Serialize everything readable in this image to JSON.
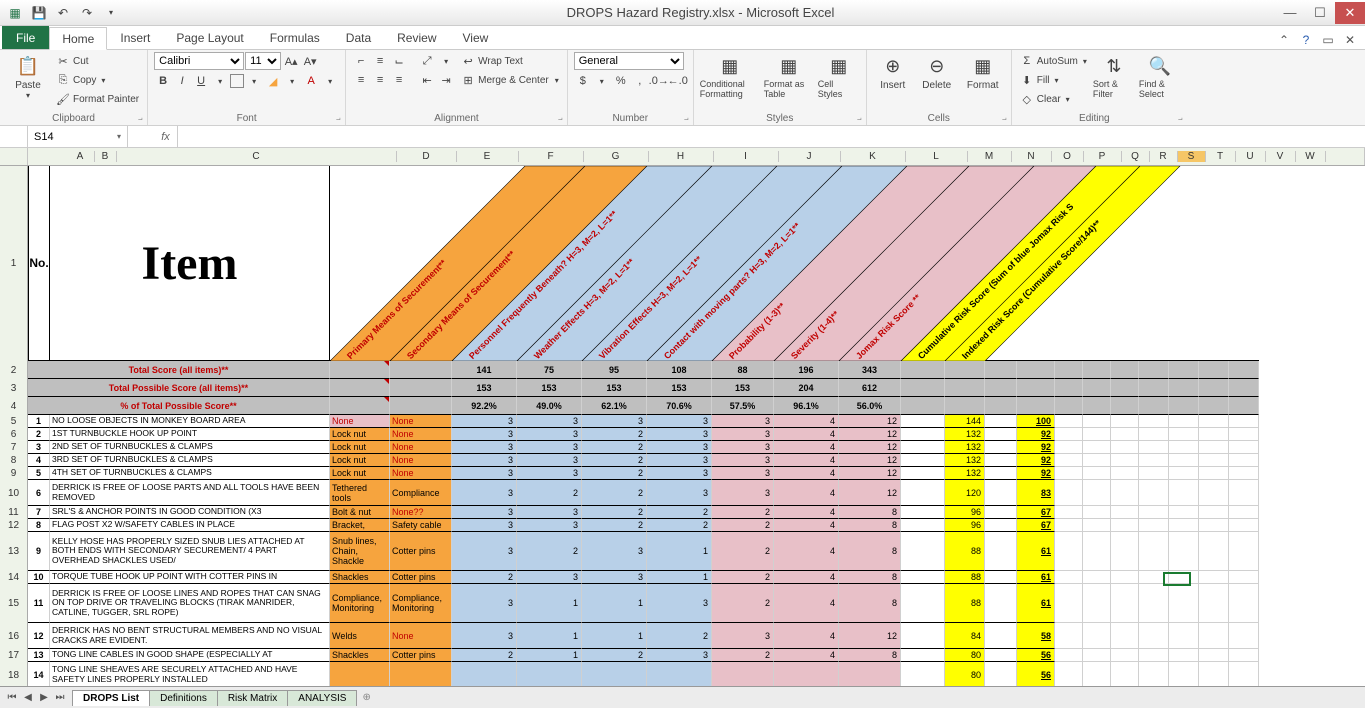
{
  "app": {
    "title": "DROPS Hazard Registry.xlsx - Microsoft Excel"
  },
  "ribbon": {
    "file": "File",
    "tabs": [
      "Home",
      "Insert",
      "Page Layout",
      "Formulas",
      "Data",
      "Review",
      "View"
    ],
    "clipboard": {
      "paste": "Paste",
      "cut": "Cut",
      "copy": "Copy",
      "fp": "Format Painter",
      "label": "Clipboard"
    },
    "font": {
      "name": "Calibri",
      "size": "11",
      "label": "Font"
    },
    "alignment": {
      "wrap": "Wrap Text",
      "merge": "Merge & Center",
      "label": "Alignment"
    },
    "number": {
      "fmt": "General",
      "label": "Number"
    },
    "styles": {
      "cf": "Conditional Formatting",
      "fat": "Format as Table",
      "cs": "Cell Styles",
      "label": "Styles"
    },
    "cells": {
      "ins": "Insert",
      "del": "Delete",
      "fmt": "Format",
      "label": "Cells"
    },
    "editing": {
      "as": "AutoSum",
      "fill": "Fill",
      "clear": "Clear",
      "sort": "Sort & Filter",
      "find": "Find & Select",
      "label": "Editing"
    }
  },
  "namebox": "S14",
  "sheets": [
    "DROPS List",
    "Definitions",
    "Risk Matrix",
    "ANALYSIS"
  ],
  "header_big": {
    "no": "No.",
    "item": "Item"
  },
  "diag": [
    "Primary Means of Securement**",
    "Secondary Means of Securement**",
    "Personnel Frequently Beneath? H=3, M=2, L=1**",
    "Weather Effects H=3, M=2, L=1**",
    "Vibration Effects H=3, M=2, L=1**",
    "Contact with moving parts? H=3, M=2, L=1**",
    "Probability (1-3)**",
    "Severity (1-4)**",
    "Jomax Risk Score **",
    "Cumulative Risk Score (Sum of blue Jomax Risk S",
    "Indexed Risk Score (Cumulative Score/144)**"
  ],
  "summary": {
    "r2_label": "Total Score (all items)**",
    "r3_label": "Total Possible Score (all items)**",
    "r4_label": "% of Total Possible Score**",
    "r2": [
      "141",
      "75",
      "95",
      "108",
      "88",
      "196",
      "343"
    ],
    "r3": [
      "153",
      "153",
      "153",
      "153",
      "153",
      "204",
      "612"
    ],
    "r4": [
      "92.2%",
      "49.0%",
      "62.1%",
      "70.6%",
      "57.5%",
      "96.1%",
      "56.0%"
    ]
  },
  "rows": [
    {
      "n": "1",
      "item": "NO LOOSE OBJECTS IN MONKEY BOARD AREA",
      "d": "None",
      "e": "None",
      "f": "3",
      "g": "3",
      "h": "3",
      "i": "3",
      "j": "3",
      "k": "4",
      "l": "12",
      "o": "144",
      "p": "100"
    },
    {
      "n": "2",
      "item": "1ST TURNBUCKLE HOOK UP POINT",
      "d": "Lock nut",
      "e": "None",
      "f": "3",
      "g": "3",
      "h": "2",
      "i": "3",
      "j": "3",
      "k": "4",
      "l": "12",
      "o": "132",
      "p": "92"
    },
    {
      "n": "3",
      "item": "2ND SET OF TURNBUCKLES & CLAMPS",
      "d": "Lock nut",
      "e": "None",
      "f": "3",
      "g": "3",
      "h": "2",
      "i": "3",
      "j": "3",
      "k": "4",
      "l": "12",
      "o": "132",
      "p": "92"
    },
    {
      "n": "4",
      "item": "3RD SET OF TURNBUCKLES & CLAMPS",
      "d": "Lock nut",
      "e": "None",
      "f": "3",
      "g": "3",
      "h": "2",
      "i": "3",
      "j": "3",
      "k": "4",
      "l": "12",
      "o": "132",
      "p": "92"
    },
    {
      "n": "5",
      "item": "4TH SET OF TURNBUCKLES & CLAMPS",
      "d": "Lock nut",
      "e": "None",
      "f": "3",
      "g": "3",
      "h": "2",
      "i": "3",
      "j": "3",
      "k": "4",
      "l": "12",
      "o": "132",
      "p": "92"
    },
    {
      "n": "6",
      "item": "DERRICK IS FREE OF LOOSE PARTS AND ALL TOOLS HAVE BEEN REMOVED",
      "d": "Tethered tools",
      "e": "Compliance",
      "f": "3",
      "g": "2",
      "h": "2",
      "i": "3",
      "j": "3",
      "k": "4",
      "l": "12",
      "o": "120",
      "p": "83",
      "h2": true
    },
    {
      "n": "7",
      "item": "SRL'S & ANCHOR POINTS IN GOOD CONDITION (X3",
      "d": "Bolt & nut",
      "e": "None??",
      "f": "3",
      "g": "3",
      "h": "2",
      "i": "2",
      "j": "2",
      "k": "4",
      "l": "8",
      "o": "96",
      "p": "67"
    },
    {
      "n": "8",
      "item": "FLAG POST X2 W/SAFETY CABLES IN PLACE",
      "d": "Bracket,",
      "e": "Safety cable",
      "f": "3",
      "g": "3",
      "h": "2",
      "i": "2",
      "j": "2",
      "k": "4",
      "l": "8",
      "o": "96",
      "p": "67"
    },
    {
      "n": "9",
      "item": "KELLY HOSE HAS PROPERLY SIZED SNUB LIES ATTACHED AT BOTH ENDS WITH SECONDARY SECUREMENT/ 4 PART OVERHEAD SHACKLES USED/",
      "d": "Snub lines, Chain, Shackle",
      "e": "Cotter pins",
      "f": "3",
      "g": "2",
      "h": "3",
      "i": "1",
      "j": "2",
      "k": "4",
      "l": "8",
      "o": "88",
      "p": "61",
      "h3": true
    },
    {
      "n": "10",
      "item": "TORQUE TUBE HOOK UP POINT WITH COTTER PINS IN",
      "d": "Shackles",
      "e": "Cotter pins",
      "f": "2",
      "g": "3",
      "h": "3",
      "i": "1",
      "j": "2",
      "k": "4",
      "l": "8",
      "o": "88",
      "p": "61"
    },
    {
      "n": "11",
      "item": "DERRICK IS FREE OF LOOSE LINES AND ROPES THAT CAN SNAG ON TOP DRIVE OR TRAVELING BLOCKS (TIRAK MANRIDER, CATLINE, TUGGER, SRL ROPE)",
      "d": "Compliance, Monitoring",
      "e": "Compliance, Monitoring",
      "f": "3",
      "g": "1",
      "h": "1",
      "i": "3",
      "j": "2",
      "k": "4",
      "l": "8",
      "o": "88",
      "p": "61",
      "h3": true
    },
    {
      "n": "12",
      "item": "DERRICK HAS NO BENT STRUCTURAL MEMBERS AND NO VISUAL CRACKS ARE EVIDENT.",
      "d": "Welds",
      "e": "None",
      "f": "3",
      "g": "1",
      "h": "1",
      "i": "2",
      "j": "3",
      "k": "4",
      "l": "12",
      "o": "84",
      "p": "58",
      "h2": true
    },
    {
      "n": "13",
      "item": "TONG LINE CABLES IN GOOD SHAPE (ESPECIALLY AT",
      "d": "Shackles",
      "e": "Cotter pins",
      "f": "2",
      "g": "1",
      "h": "2",
      "i": "3",
      "j": "2",
      "k": "4",
      "l": "8",
      "o": "80",
      "p": "56"
    },
    {
      "n": "14",
      "item": "TONG LINE SHEAVES ARE SECURELY ATTACHED AND HAVE SAFETY LINES PROPERLY INSTALLED",
      "d": "",
      "e": "",
      "f": "",
      "g": "",
      "h": "",
      "i": "",
      "j": "",
      "k": "",
      "l": "",
      "o": "80",
      "p": "56",
      "h2": true
    }
  ],
  "cols": [
    "A",
    "B",
    "C",
    "D",
    "E",
    "F",
    "G",
    "H",
    "I",
    "J",
    "K",
    "L",
    "M",
    "N",
    "O",
    "P",
    "Q",
    "R",
    "S",
    "T",
    "U",
    "V",
    "W"
  ]
}
